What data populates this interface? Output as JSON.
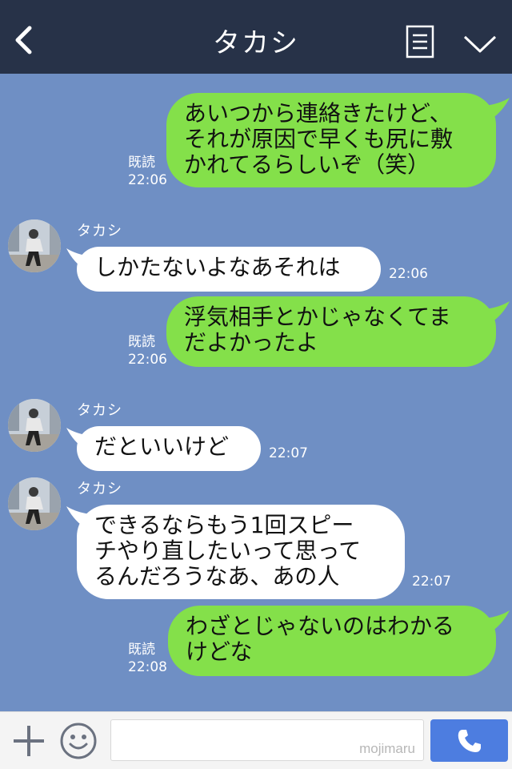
{
  "header": {
    "title": "タカシ"
  },
  "messages": [
    {
      "side": "mine",
      "lines": [
        "あいつから連絡きたけど、",
        "それが原因で早くも尻に敷",
        "かれてるらしいぞ（笑）"
      ],
      "read": "既読",
      "time": "22:06"
    },
    {
      "side": "theirs",
      "sender": "タカシ",
      "lines": [
        "しかたないよなあそれは"
      ],
      "time": "22:06"
    },
    {
      "side": "mine",
      "lines": [
        "浮気相手とかじゃなくてま",
        "だよかったよ"
      ],
      "read": "既読",
      "time": "22:06"
    },
    {
      "side": "theirs",
      "sender": "タカシ",
      "lines": [
        "だといいけど"
      ],
      "time": "22:07"
    },
    {
      "side": "theirs",
      "sender": "タカシ",
      "lines": [
        "できるならもう1回スピー",
        "チやり直したいって思って",
        "るんだろうなあ、あの人"
      ],
      "time": "22:07"
    },
    {
      "side": "mine",
      "lines": [
        "わざとじゃないのはわかる",
        "けどな"
      ],
      "read": "既読",
      "time": "22:08"
    }
  ],
  "input": {
    "watermark": "mojimaru"
  },
  "icons": {
    "back": "back-chevron-icon",
    "menu": "note-menu-icon",
    "collapse": "chevron-down-icon",
    "add": "plus-icon",
    "emoji": "smiley-icon",
    "call": "phone-icon"
  },
  "colors": {
    "header": "#273248",
    "background": "#6f8fc4",
    "mine": "#84e04a",
    "theirs": "#ffffff",
    "call": "#4d7de0"
  }
}
